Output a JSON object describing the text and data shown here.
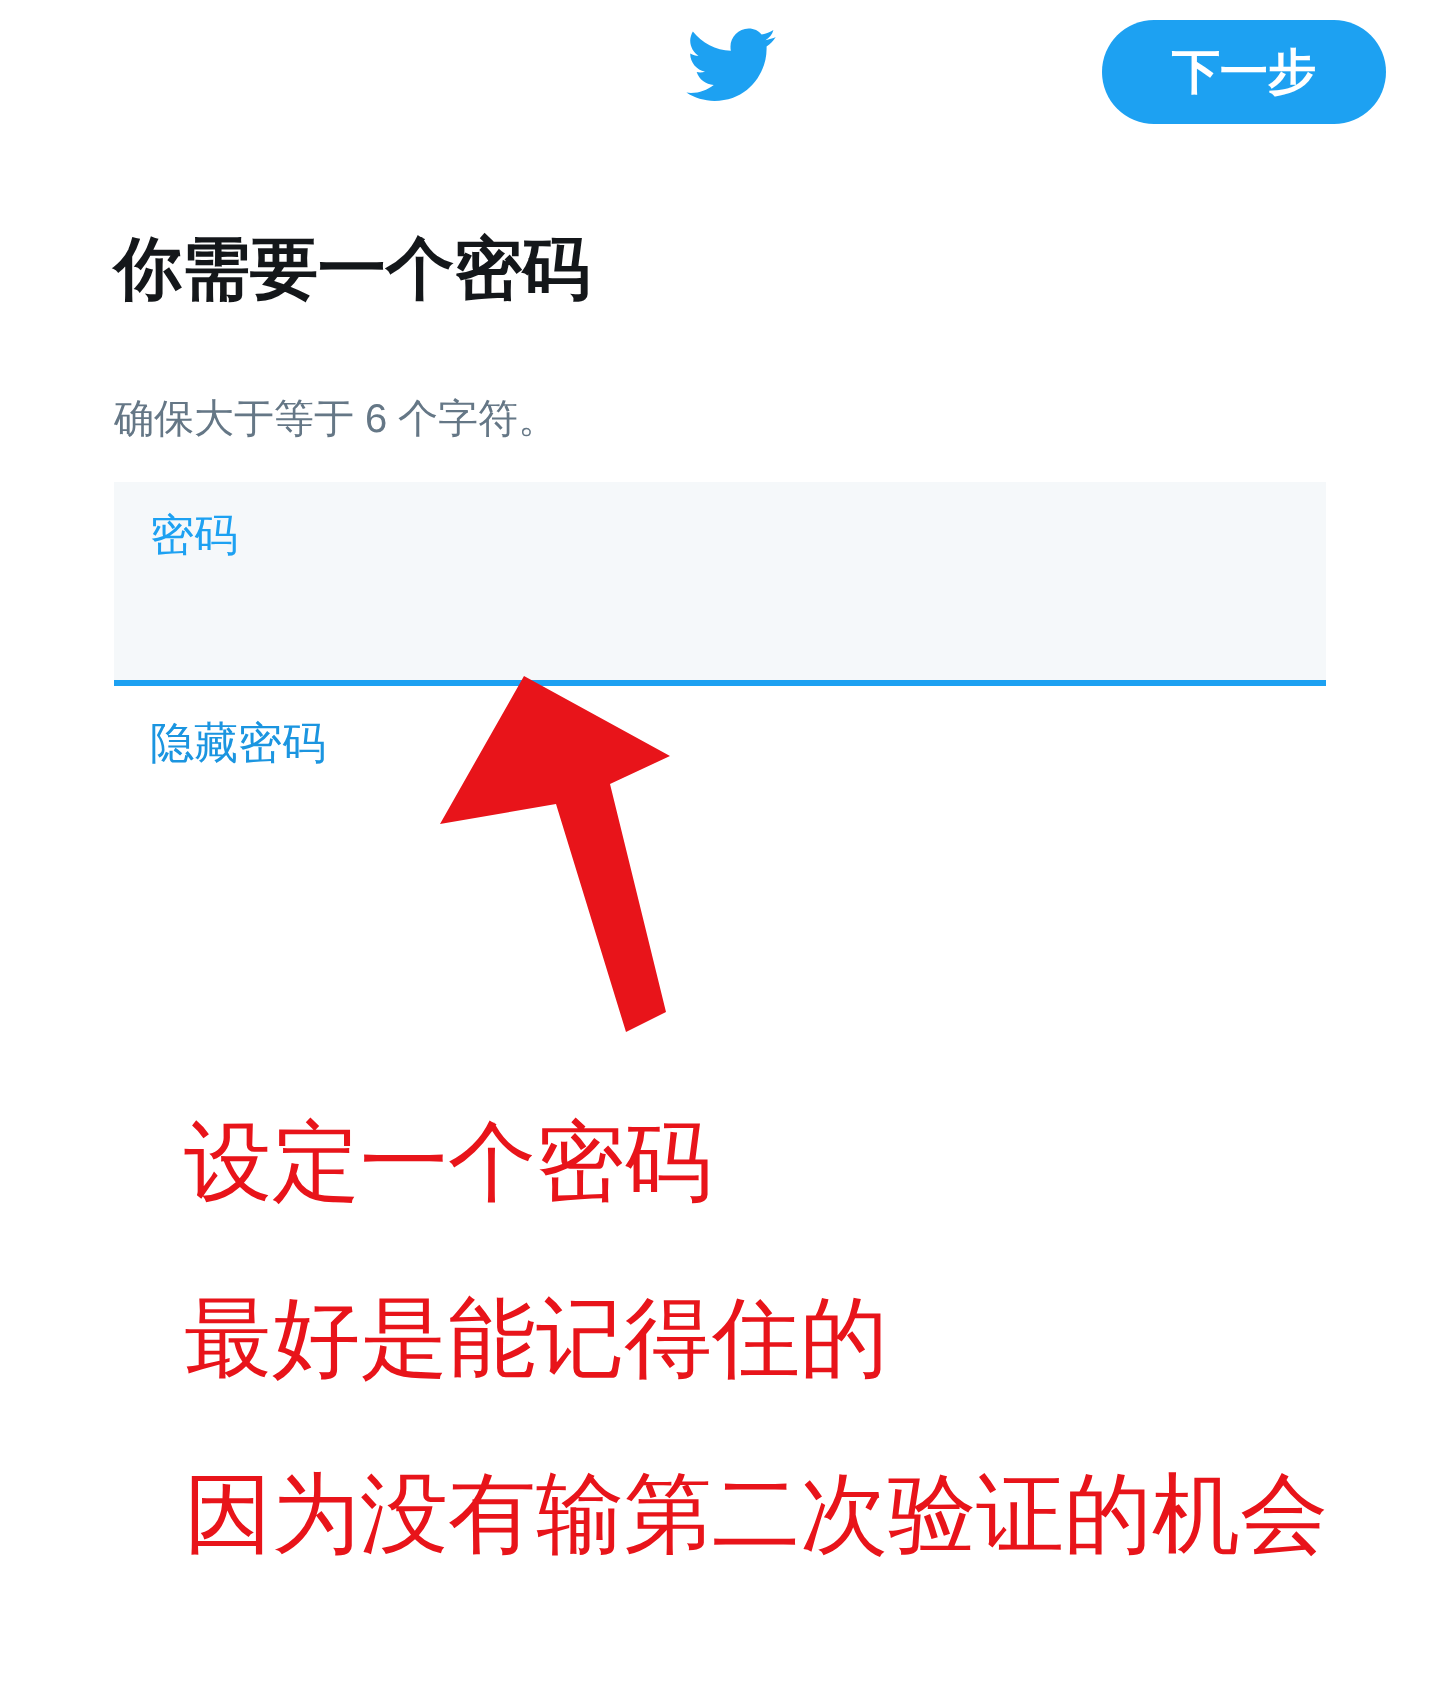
{
  "header": {
    "next_button": "下一步"
  },
  "title": "你需要一个密码",
  "subtitle": "确保大于等于 6 个字符。",
  "password_field": {
    "label": "密码"
  },
  "hide_password_link": "隐藏密码",
  "annotations": [
    "设定一个密码",
    "最好是能记得住的",
    "因为没有输第二次验证的机会"
  ]
}
